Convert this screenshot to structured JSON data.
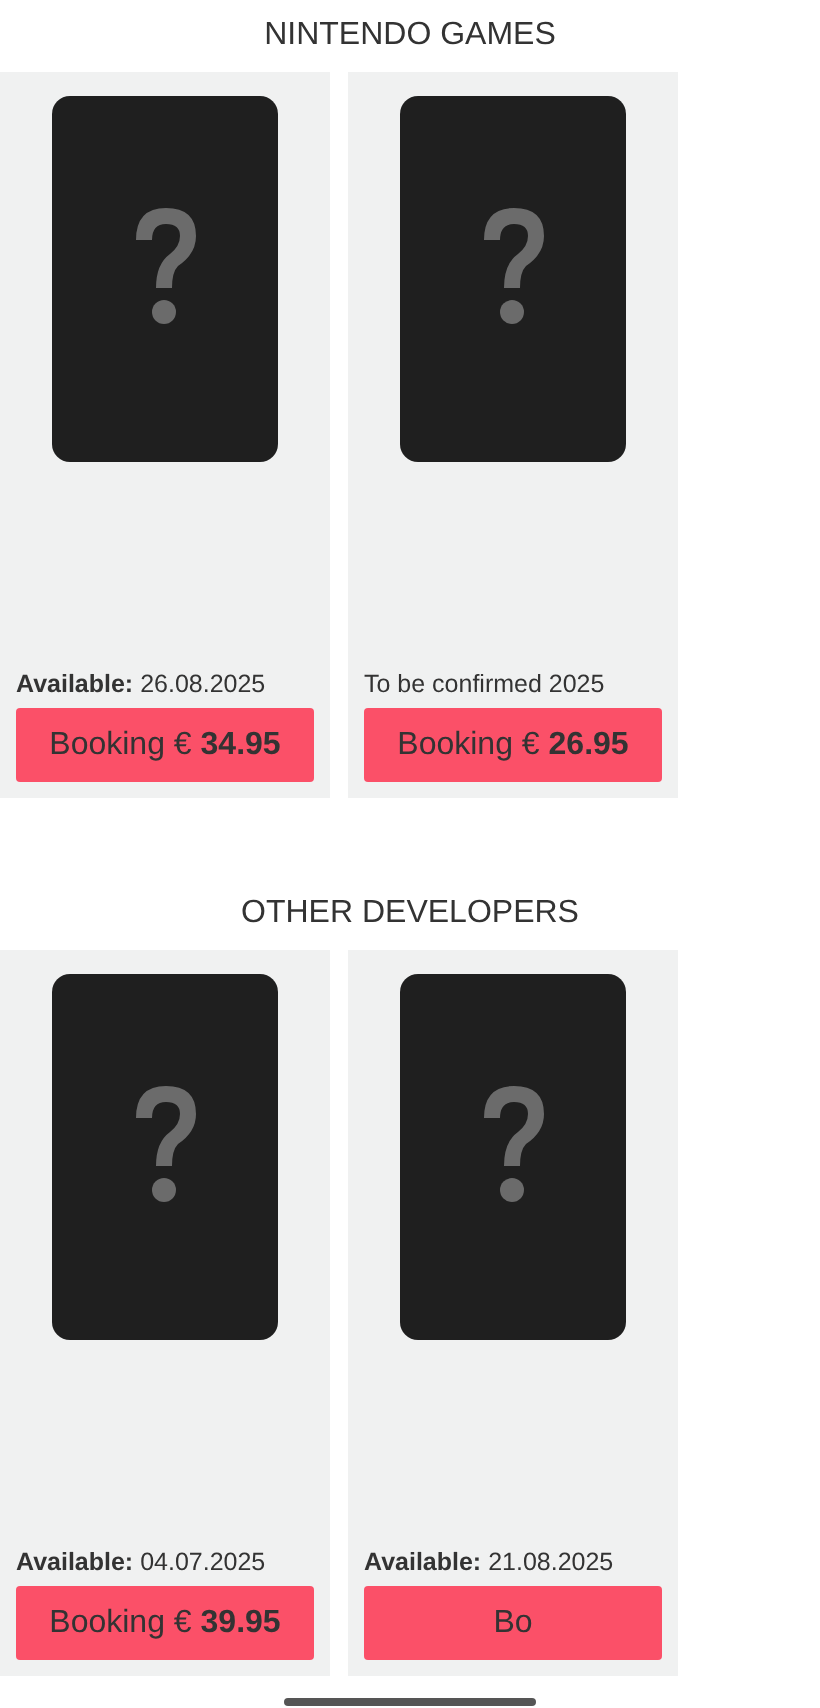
{
  "sections": [
    {
      "title": "NINTENDO GAMES",
      "products": [
        {
          "kind": "available",
          "availability_label": "Available:",
          "availability_date": "26.08.2025",
          "button_prefix": "Booking €",
          "button_price": "34.95"
        },
        {
          "kind": "note",
          "availability_note": "To be confirmed 2025",
          "button_prefix": "Booking €",
          "button_price": "26.95"
        }
      ]
    },
    {
      "title": "OTHER DEVELOPERS",
      "products": [
        {
          "kind": "available",
          "availability_label": "Available:",
          "availability_date": "04.07.2025",
          "button_prefix": "Booking €",
          "button_price": "39.95"
        },
        {
          "kind": "available",
          "availability_label": "Available:",
          "availability_date": "21.08.2025",
          "button_prefix": "Bo"
        }
      ]
    }
  ]
}
